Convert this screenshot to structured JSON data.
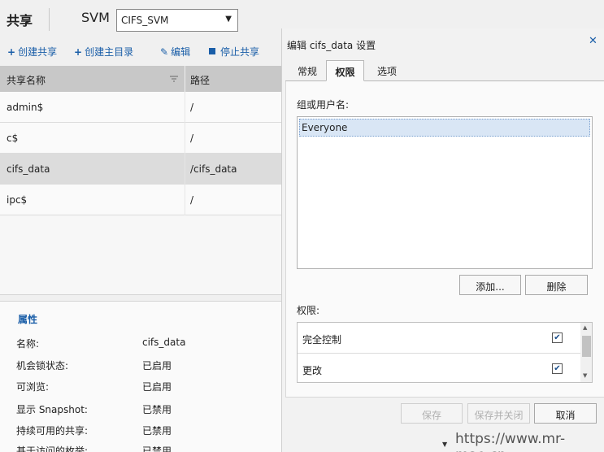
{
  "header": {
    "title": "共享",
    "svm_label": "SVM",
    "svm_selected": "CIFS_SVM"
  },
  "toolbar": {
    "create_share": "创建共享",
    "create_home_dir": "创建主目录",
    "edit": "编辑",
    "stop_share": "停止共享"
  },
  "table": {
    "columns": [
      "共享名称",
      "路径"
    ],
    "rows": [
      {
        "name": "admin$",
        "path": "/"
      },
      {
        "name": "c$",
        "path": "/"
      },
      {
        "name": "cifs_data",
        "path": "/cifs_data"
      },
      {
        "name": "ipc$",
        "path": "/"
      }
    ],
    "selected_index": 2
  },
  "properties": {
    "title": "属性",
    "items": [
      {
        "key": "名称:",
        "value": "cifs_data"
      },
      {
        "key": "机会锁状态:",
        "value": "已启用"
      },
      {
        "key": "可浏览:",
        "value": "已启用"
      },
      {
        "key": "显示 Snapshot:",
        "value": "已禁用"
      },
      {
        "key": "持续可用的共享:",
        "value": "已禁用"
      },
      {
        "key": "基于访问的枚举:",
        "value": "已禁用"
      }
    ]
  },
  "dialog": {
    "title": "编辑 cifs_data 设置",
    "close_glyph": "✕",
    "tabs": [
      "常规",
      "权限",
      "选项"
    ],
    "active_tab": 1,
    "group_label": "组或用户名:",
    "users": [
      "Everyone"
    ],
    "add_button": "添加...",
    "delete_button": "删除",
    "permissions_label": "权限:",
    "permissions": [
      {
        "name": "完全控制",
        "checked": true
      },
      {
        "name": "更改",
        "checked": true
      }
    ],
    "save_button": "保存",
    "save_close_button": "保存并关闭",
    "cancel_button": "取消"
  },
  "watermark": "https://www.mr-mao.cn",
  "colors": {
    "accent": "#1a5ea8",
    "header_bg": "#c8c8c8",
    "selection_bg": "#d9e6f5"
  }
}
